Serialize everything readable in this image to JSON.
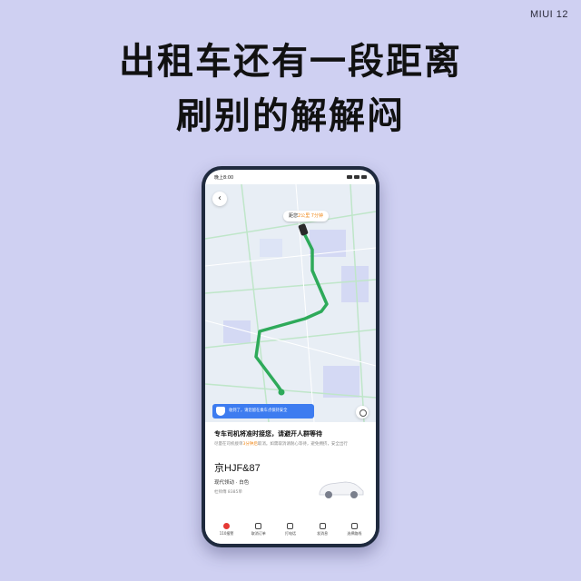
{
  "brand": "MIUI 12",
  "headline": {
    "line1": "出租车还有一段距离",
    "line2": "刷别的解解闷"
  },
  "phone": {
    "status_time": "晚上8:00",
    "eta_pill": {
      "prefix": "距您",
      "highlight": "2公里 7分钟"
    },
    "safety_banner": "收到了，请您留在乘车点保持安全",
    "card": {
      "title": "专车司机将准时接您，请避开人群等待",
      "subtitle_prefix": "尽量在司机接单",
      "subtitle_highlight": "3分钟后",
      "subtitle_suffix": "取消。如需取消请耐心等待，避免拥挤，安全出行",
      "plate": "京HJF&87",
      "car_model": "现代领动 · 白色",
      "driver": "杜师傅  8385单"
    },
    "actions": [
      {
        "label": "110报警",
        "icon": "alarm-icon"
      },
      {
        "label": "取消订单",
        "icon": "cancel-icon"
      },
      {
        "label": "打电话",
        "icon": "phone-icon"
      },
      {
        "label": "发消息",
        "icon": "message-icon"
      },
      {
        "label": "选择路线",
        "icon": "route-icon"
      }
    ]
  },
  "colors": {
    "background": "#cfd0f2",
    "route": "#2eaa5a",
    "accent": "#3d7cf0",
    "highlight": "#f08a1c"
  }
}
